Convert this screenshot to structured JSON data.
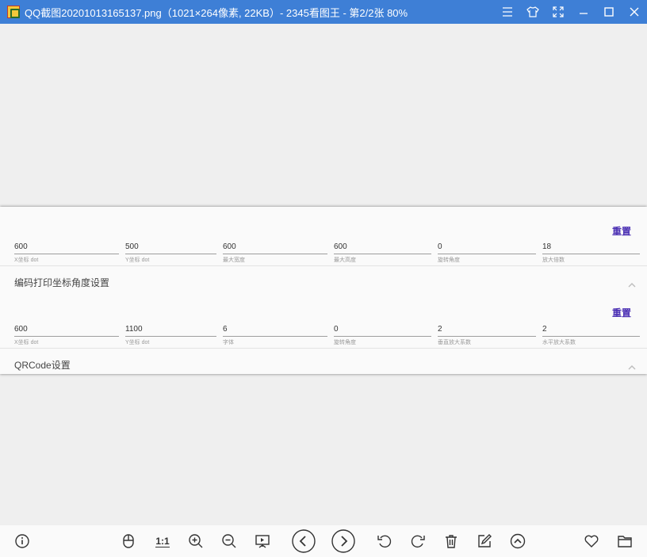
{
  "window": {
    "title": "QQ截图20201013165137.png（1021×264像素, 22KB）- 2345看图王 - 第2/2张 80%"
  },
  "title_controls": [
    {
      "name": "menu-icon"
    },
    {
      "name": "skin-icon"
    },
    {
      "name": "fullscreen-icon"
    },
    {
      "name": "minimize-icon"
    },
    {
      "name": "maximize-icon"
    },
    {
      "name": "close-icon"
    }
  ],
  "panel": {
    "group1": {
      "reset_label": "重置",
      "fields": [
        {
          "value": "600",
          "label": "X坐标 dot"
        },
        {
          "value": "500",
          "label": "Y坐标 dot"
        },
        {
          "value": "600",
          "label": "最大宽度"
        },
        {
          "value": "600",
          "label": "最大高度"
        },
        {
          "value": "0",
          "label": "旋转角度"
        },
        {
          "value": "18",
          "label": "放大倍数"
        }
      ]
    },
    "section1_title": "编码打印坐标角度设置",
    "group2": {
      "reset_label": "重置",
      "fields": [
        {
          "value": "600",
          "label": "X坐标 dot"
        },
        {
          "value": "1100",
          "label": "Y坐标 dot"
        },
        {
          "value": "6",
          "label": "字体"
        },
        {
          "value": "0",
          "label": "旋转角度"
        },
        {
          "value": "2",
          "label": "垂直放大系数"
        },
        {
          "value": "2",
          "label": "水平放大系数"
        }
      ]
    },
    "section2_title": "QRCode设置"
  },
  "toolbar": {
    "actual_size_label": "1:1",
    "icons": [
      "info-icon",
      "mouse-icon",
      "actual-size-icon",
      "zoom-in-icon",
      "zoom-out-icon",
      "slideshow-icon",
      "previous-icon",
      "next-icon",
      "rotate-left-icon",
      "rotate-right-icon",
      "delete-icon",
      "edit-icon",
      "more-icon",
      "favorite-icon",
      "folder-icon"
    ]
  },
  "colors": {
    "titlebar": "#3e7fd6",
    "accent": "#4a2fb3"
  }
}
